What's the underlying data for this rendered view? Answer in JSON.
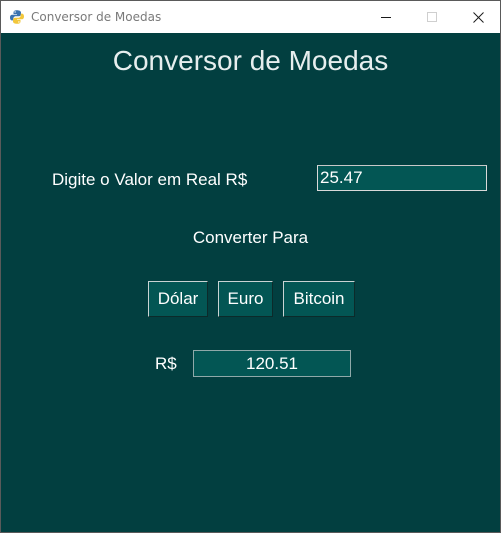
{
  "window": {
    "title": "Conversor de Moedas",
    "app_icon": "python-icon",
    "controls": {
      "minimize_icon": "minimize-icon",
      "maximize_icon": "maximize-icon",
      "close_icon": "close-icon"
    }
  },
  "main": {
    "heading": "Conversor de Moedas",
    "input_label": "Digite o Valor em Real R$",
    "input_value": "25.47",
    "convert_label": "Converter Para",
    "buttons": {
      "dolar": "Dólar",
      "euro": "Euro",
      "bitcoin": "Bitcoin"
    },
    "result_prefix": "R$",
    "result_value": "120.51"
  },
  "colors": {
    "background": "#023f40",
    "field_background": "#035654",
    "text": "#ffffff",
    "heading_text": "#e6eeee"
  }
}
